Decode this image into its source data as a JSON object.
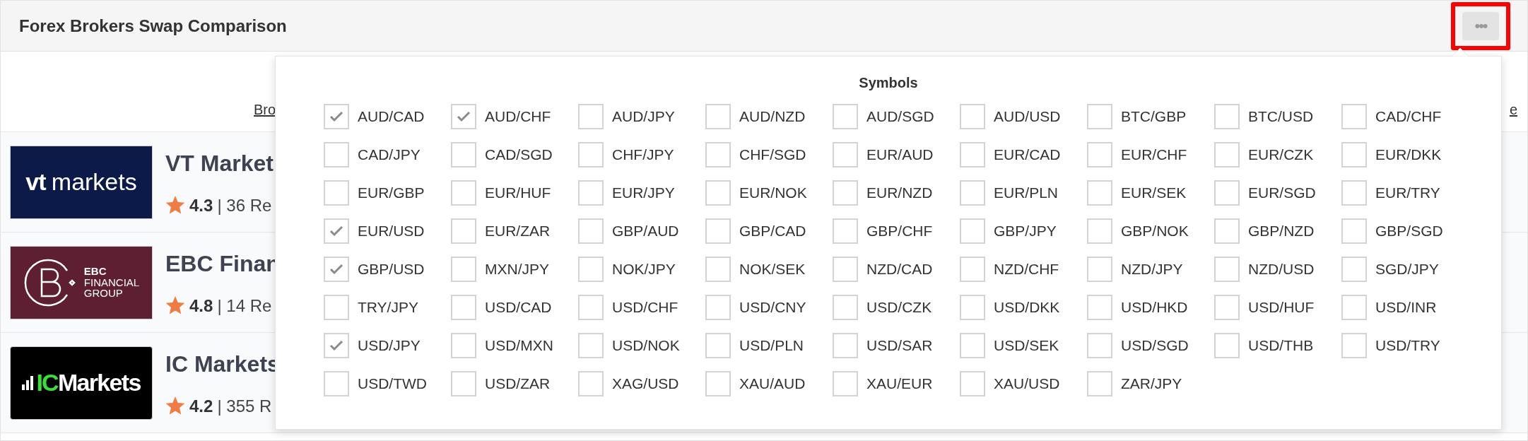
{
  "header": {
    "title": "Forex Brokers Swap Comparison",
    "menu_button": "•••"
  },
  "table": {
    "header_left": "Bro",
    "header_right": "e",
    "rows": [
      {
        "logo": {
          "kind": "vt",
          "parts": [
            "vt",
            "markets"
          ]
        },
        "name": "VT Market",
        "rating": "4.3",
        "reviews": "| 36 Re"
      },
      {
        "logo": {
          "kind": "ebc",
          "parts": [
            "EBC",
            "FINANCIAL",
            "GROUP"
          ]
        },
        "name": "EBC Finan",
        "rating": "4.8",
        "reviews": "| 14 Re"
      },
      {
        "logo": {
          "kind": "ic",
          "parts": [
            "IC",
            "Markets"
          ]
        },
        "name": "IC Markets",
        "rating": "4.2",
        "reviews": "| 355 R"
      }
    ]
  },
  "symbols_menu": {
    "title": "Symbols",
    "items": [
      {
        "label": "AUD/CAD",
        "checked": true
      },
      {
        "label": "AUD/CHF",
        "checked": true
      },
      {
        "label": "AUD/JPY",
        "checked": false
      },
      {
        "label": "AUD/NZD",
        "checked": false
      },
      {
        "label": "AUD/SGD",
        "checked": false
      },
      {
        "label": "AUD/USD",
        "checked": false
      },
      {
        "label": "BTC/GBP",
        "checked": false
      },
      {
        "label": "BTC/USD",
        "checked": false
      },
      {
        "label": "CAD/CHF",
        "checked": false
      },
      {
        "label": "CAD/JPY",
        "checked": false
      },
      {
        "label": "CAD/SGD",
        "checked": false
      },
      {
        "label": "CHF/JPY",
        "checked": false
      },
      {
        "label": "CHF/SGD",
        "checked": false
      },
      {
        "label": "EUR/AUD",
        "checked": false
      },
      {
        "label": "EUR/CAD",
        "checked": false
      },
      {
        "label": "EUR/CHF",
        "checked": false
      },
      {
        "label": "EUR/CZK",
        "checked": false
      },
      {
        "label": "EUR/DKK",
        "checked": false
      },
      {
        "label": "EUR/GBP",
        "checked": false
      },
      {
        "label": "EUR/HUF",
        "checked": false
      },
      {
        "label": "EUR/JPY",
        "checked": false
      },
      {
        "label": "EUR/NOK",
        "checked": false
      },
      {
        "label": "EUR/NZD",
        "checked": false
      },
      {
        "label": "EUR/PLN",
        "checked": false
      },
      {
        "label": "EUR/SEK",
        "checked": false
      },
      {
        "label": "EUR/SGD",
        "checked": false
      },
      {
        "label": "EUR/TRY",
        "checked": false
      },
      {
        "label": "EUR/USD",
        "checked": true
      },
      {
        "label": "EUR/ZAR",
        "checked": false
      },
      {
        "label": "GBP/AUD",
        "checked": false
      },
      {
        "label": "GBP/CAD",
        "checked": false
      },
      {
        "label": "GBP/CHF",
        "checked": false
      },
      {
        "label": "GBP/JPY",
        "checked": false
      },
      {
        "label": "GBP/NOK",
        "checked": false
      },
      {
        "label": "GBP/NZD",
        "checked": false
      },
      {
        "label": "GBP/SGD",
        "checked": false
      },
      {
        "label": "GBP/USD",
        "checked": true
      },
      {
        "label": "MXN/JPY",
        "checked": false
      },
      {
        "label": "NOK/JPY",
        "checked": false
      },
      {
        "label": "NOK/SEK",
        "checked": false
      },
      {
        "label": "NZD/CAD",
        "checked": false
      },
      {
        "label": "NZD/CHF",
        "checked": false
      },
      {
        "label": "NZD/JPY",
        "checked": false
      },
      {
        "label": "NZD/USD",
        "checked": false
      },
      {
        "label": "SGD/JPY",
        "checked": false
      },
      {
        "label": "TRY/JPY",
        "checked": false
      },
      {
        "label": "USD/CAD",
        "checked": false
      },
      {
        "label": "USD/CHF",
        "checked": false
      },
      {
        "label": "USD/CNY",
        "checked": false
      },
      {
        "label": "USD/CZK",
        "checked": false
      },
      {
        "label": "USD/DKK",
        "checked": false
      },
      {
        "label": "USD/HKD",
        "checked": false
      },
      {
        "label": "USD/HUF",
        "checked": false
      },
      {
        "label": "USD/INR",
        "checked": false
      },
      {
        "label": "USD/JPY",
        "checked": true
      },
      {
        "label": "USD/MXN",
        "checked": false
      },
      {
        "label": "USD/NOK",
        "checked": false
      },
      {
        "label": "USD/PLN",
        "checked": false
      },
      {
        "label": "USD/SAR",
        "checked": false
      },
      {
        "label": "USD/SEK",
        "checked": false
      },
      {
        "label": "USD/SGD",
        "checked": false
      },
      {
        "label": "USD/THB",
        "checked": false
      },
      {
        "label": "USD/TRY",
        "checked": false
      },
      {
        "label": "USD/TWD",
        "checked": false
      },
      {
        "label": "USD/ZAR",
        "checked": false
      },
      {
        "label": "XAG/USD",
        "checked": false
      },
      {
        "label": "XAU/AUD",
        "checked": false
      },
      {
        "label": "XAU/EUR",
        "checked": false
      },
      {
        "label": "XAU/USD",
        "checked": false
      },
      {
        "label": "ZAR/JPY",
        "checked": false
      }
    ]
  }
}
